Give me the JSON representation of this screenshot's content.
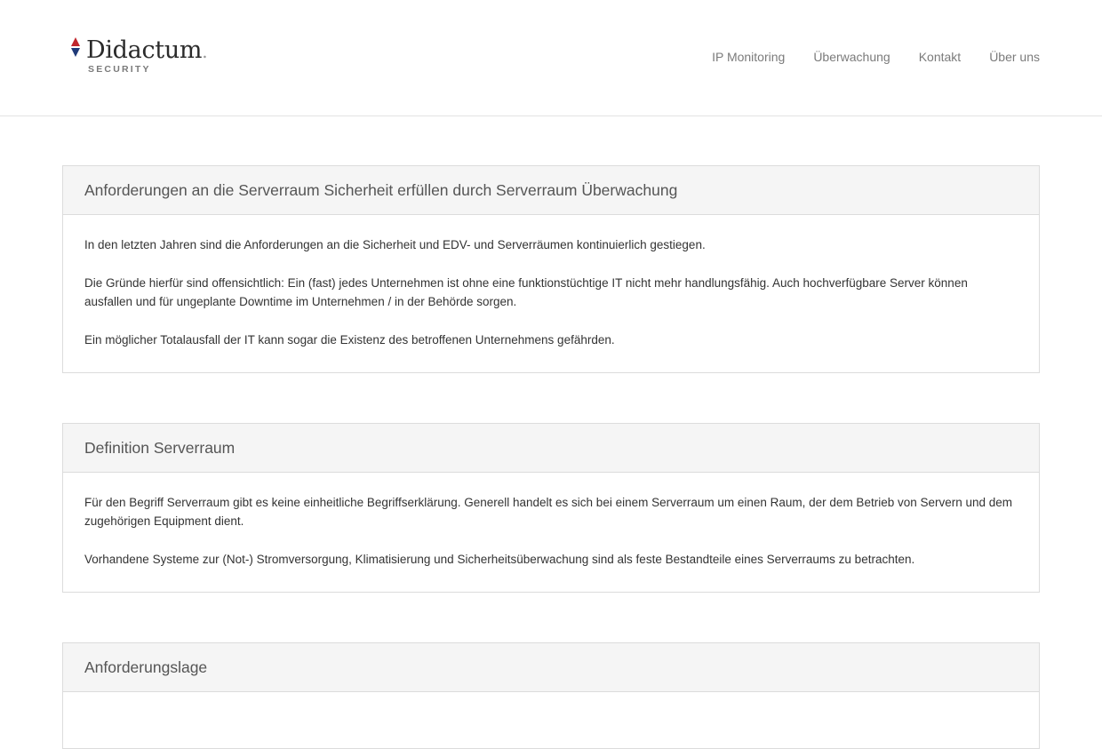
{
  "brand": {
    "name": "Didactum",
    "tagline": "SECURITY"
  },
  "nav": {
    "items": [
      {
        "label": "IP Monitoring"
      },
      {
        "label": "Überwachung"
      },
      {
        "label": "Kontakt"
      },
      {
        "label": "Über uns"
      }
    ]
  },
  "sections": [
    {
      "title": "Anforderungen an die Serverraum Sicherheit erfüllen durch Serverraum Überwachung",
      "paragraphs": [
        "In den letzten Jahren sind die Anforderungen an die Sicherheit und EDV- und Serverräumen kontinuierlich gestiegen.",
        "Die Gründe hierfür sind offensichtlich: Ein (fast) jedes Unternehmen ist ohne eine funktionstüchtige IT nicht mehr handlungsfähig. Auch hochverfügbare Server können ausfallen und für ungeplante Downtime im Unternehmen / in der Behörde sorgen.",
        "Ein möglicher Totalausfall der IT kann sogar die Existenz des betroffenen Unternehmens gefährden."
      ]
    },
    {
      "title": "Definition Serverraum",
      "paragraphs": [
        "Für den Begriff Serverraum gibt es keine einheitliche Begriffserklärung. Generell handelt es sich bei einem Serverraum um einen Raum, der dem Betrieb von Servern und dem zugehörigen Equipment dient.",
        "Vorhandene Systeme zur (Not-) Stromversorgung, Klimatisierung und Sicherheitsüberwachung sind als feste Bestandteile eines Serverraums zu betrachten."
      ]
    },
    {
      "title": "Anforderungslage",
      "paragraphs": []
    }
  ],
  "colors": {
    "logo_red": "#c0272d",
    "logo_blue": "#1f3a78",
    "nav_text": "#7b7b7b",
    "panel_header_bg": "#f5f5f5",
    "panel_border": "#dcdcdc"
  }
}
